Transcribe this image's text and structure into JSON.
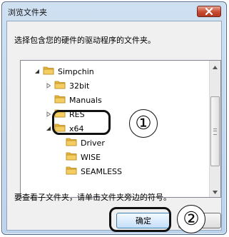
{
  "window": {
    "title": "浏览文件夹",
    "instruction": "选择包含您的硬件的驱动程序的文件夹。",
    "hint": "要查看子文件夹，请单击文件夹旁边的符号。"
  },
  "tree": {
    "items": [
      {
        "label": "Simpchin",
        "arrow": "expanded"
      },
      {
        "label": "32bit",
        "arrow": "collapsed"
      },
      {
        "label": "Manuals",
        "arrow": "none"
      },
      {
        "label": "RES",
        "arrow": "collapsed"
      },
      {
        "label": "x64",
        "arrow": "expanded"
      },
      {
        "label": "Driver",
        "arrow": "none",
        "selected": true
      },
      {
        "label": "WISE",
        "arrow": "none"
      },
      {
        "label": "SEAMLESS",
        "arrow": "none"
      }
    ]
  },
  "buttons": {
    "ok_label": "确定",
    "cancel_label": ""
  },
  "callouts": {
    "one": "①",
    "two": "②"
  },
  "colors": {
    "title_bar": "#c7dcf0",
    "close_button": "#c84a31",
    "folder": "#e8b53a",
    "annotation": "#111111"
  },
  "icons": [
    "close-icon",
    "folder-icon",
    "expand-arrow-icon",
    "collapse-arrow-icon",
    "scroll-up-icon",
    "scroll-down-icon"
  ]
}
